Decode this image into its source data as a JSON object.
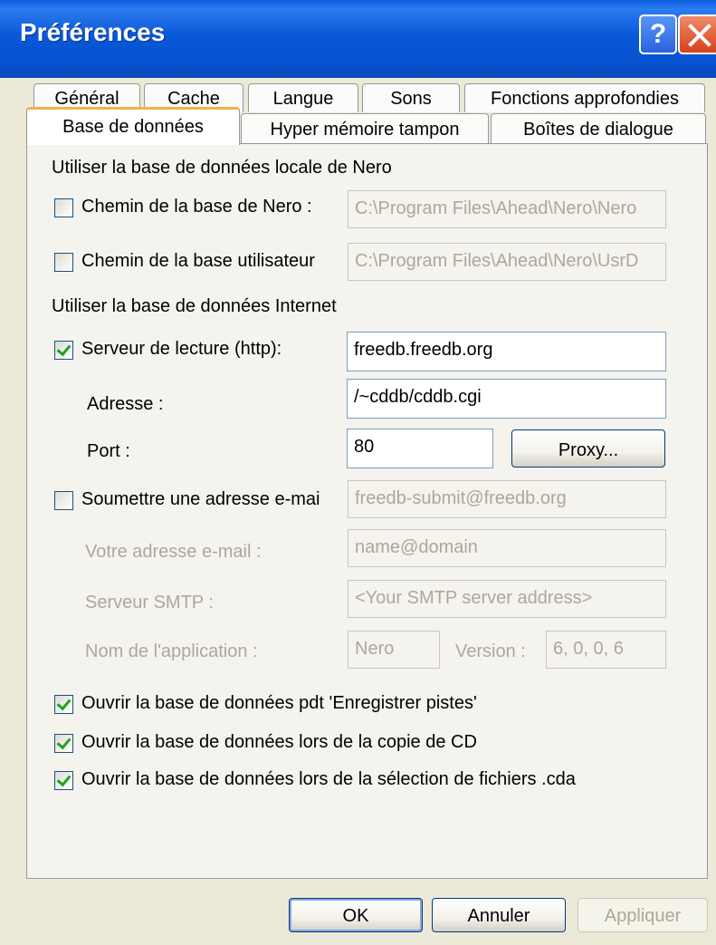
{
  "window": {
    "title": "Préférences"
  },
  "tabs": {
    "row1": [
      "Général",
      "Cache",
      "Langue",
      "Sons",
      "Fonctions approfondies"
    ],
    "row2": [
      "Base de données",
      "Hyper mémoire tampon",
      "Boîtes de dialogue"
    ]
  },
  "local": {
    "section": "Utiliser la base de données locale de Nero",
    "nero_path_label": "Chemin de la base de Nero :",
    "nero_path_value": "C:\\Program Files\\Ahead\\Nero\\Nero",
    "user_path_label": "Chemin de la base utilisateur",
    "user_path_value": "C:\\Program Files\\Ahead\\Nero\\UsrD"
  },
  "internet": {
    "section": "Utiliser la base de données Internet",
    "server_label": "Serveur de lecture (http):",
    "server_value": "freedb.freedb.org",
    "address_label": "Adresse :",
    "address_value": "/~cddb/cddb.cgi",
    "port_label": "Port :",
    "port_value": "80",
    "proxy_label": "Proxy...",
    "submit_label": "Soumettre une adresse e-mai",
    "submit_value": "freedb-submit@freedb.org",
    "email_label": "Votre adresse e-mail :",
    "email_value": "name@domain",
    "smtp_label": "Serveur SMTP :",
    "smtp_value": "<Your SMTP server address>",
    "app_label": "Nom de l'application :",
    "app_value": "Nero",
    "version_label": "Version :",
    "version_value": "6, 0, 0, 6"
  },
  "options": {
    "open_record": "Ouvrir la base de données pdt 'Enregistrer pistes'",
    "open_copy": "Ouvrir la base de données lors de la copie de CD",
    "open_cda": "Ouvrir la base de données lors de la sélection de fichiers .cda"
  },
  "buttons": {
    "ok": "OK",
    "cancel": "Annuler",
    "apply": "Appliquer"
  }
}
